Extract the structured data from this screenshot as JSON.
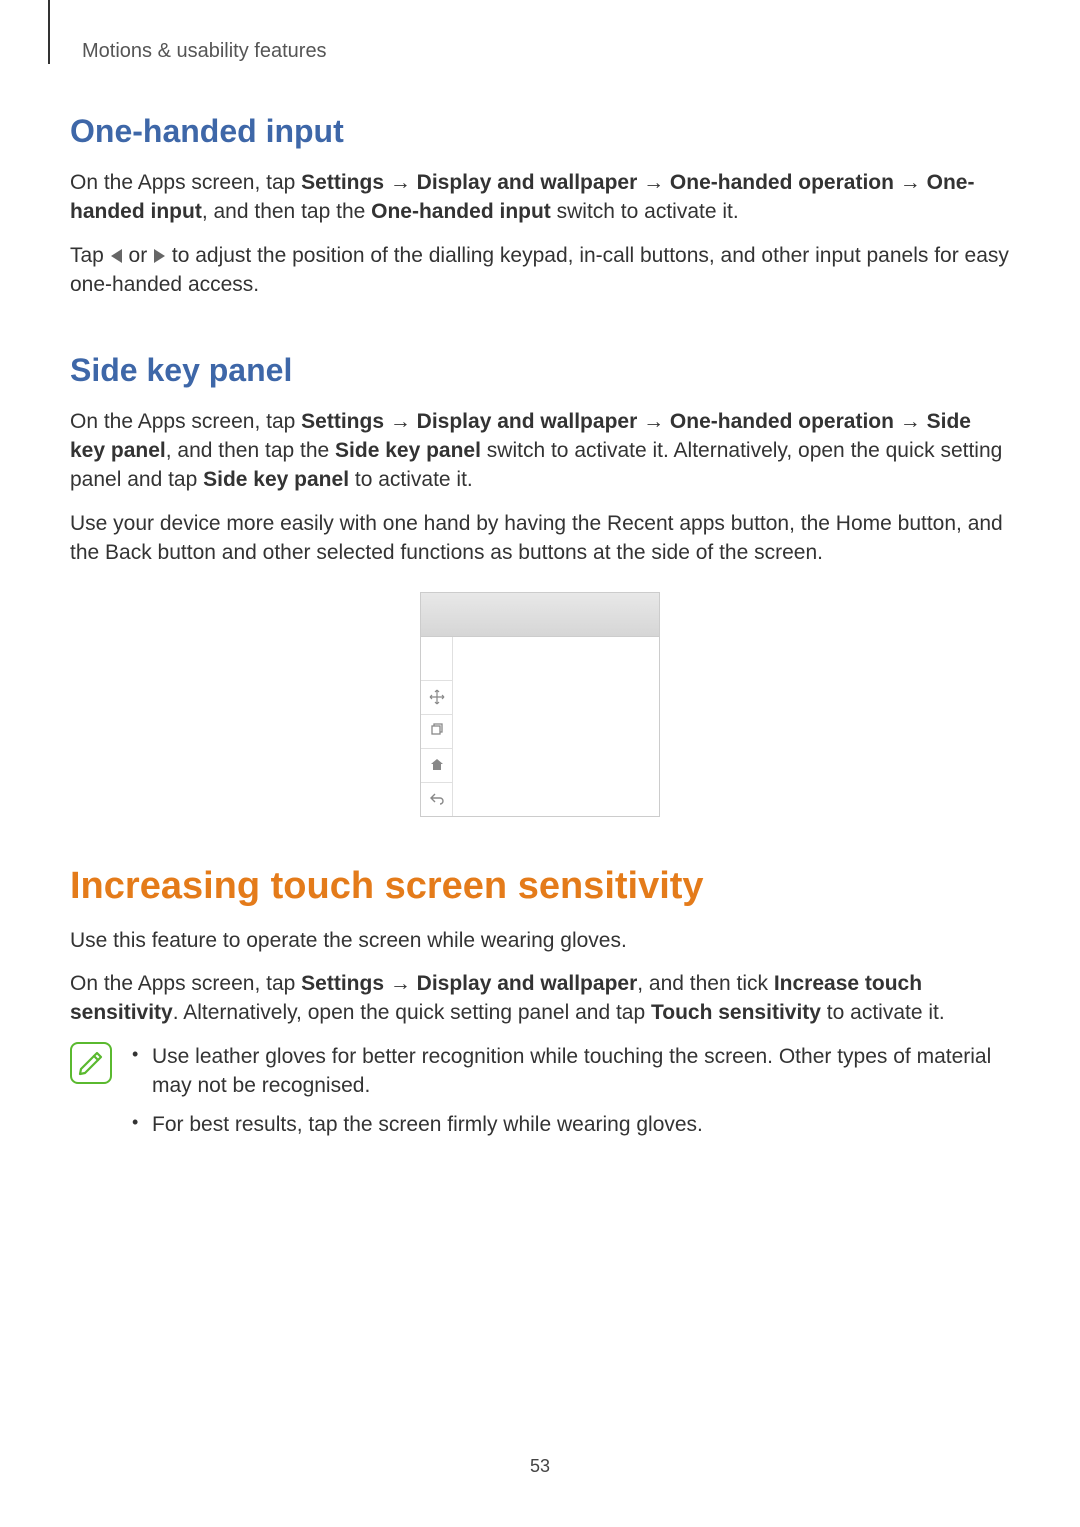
{
  "breadcrumb": "Motions & usability features",
  "sections": {
    "oneHanded": {
      "title": "One-handed input",
      "p1_pre": "On the Apps screen, tap ",
      "p1_b1": "Settings",
      "p1_arr1": " → ",
      "p1_b2": "Display and wallpaper",
      "p1_arr2": " → ",
      "p1_b3": "One-handed operation",
      "p1_arr3": " → ",
      "p1_b4": "One-handed input",
      "p1_mid": ", and then tap the ",
      "p1_b5": "One-handed input",
      "p1_post": " switch to activate it.",
      "p2_pre": "Tap ",
      "p2_or": " or ",
      "p2_post": " to adjust the position of the dialling keypad, in-call buttons, and other input panels for easy one-handed access."
    },
    "sideKey": {
      "title": "Side key panel",
      "p1_pre": "On the Apps screen, tap ",
      "p1_b1": "Settings",
      "p1_arr1": " → ",
      "p1_b2": "Display and wallpaper",
      "p1_arr2": " → ",
      "p1_b3": "One-handed operation",
      "p1_arr3": " → ",
      "p1_b4": "Side key panel",
      "p1_mid": ", and then tap the ",
      "p1_b5": "Side key panel",
      "p1_post": " switch to activate it. Alternatively, open the quick setting panel and tap ",
      "p1_b6": "Side key panel",
      "p1_end": " to activate it.",
      "p2": "Use your device more easily with one hand by having the Recent apps button, the Home button, and the Back button and other selected functions as buttons at the side of the screen."
    },
    "touchSens": {
      "title": "Increasing touch screen sensitivity",
      "p1": "Use this feature to operate the screen while wearing gloves.",
      "p2_pre": "On the Apps screen, tap ",
      "p2_b1": "Settings",
      "p2_arr1": " → ",
      "p2_b2": "Display and wallpaper",
      "p2_mid": ", and then tick ",
      "p2_b3": "Increase touch sensitivity",
      "p2_post": ". Alternatively, open the quick setting panel and tap ",
      "p2_b4": "Touch sensitivity",
      "p2_end": " to activate it.",
      "bullets": [
        "Use leather gloves for better recognition while touching the screen. Other types of material may not be recognised.",
        "For best results, tap the screen firmly while wearing gloves."
      ]
    }
  },
  "pageNumber": "53"
}
